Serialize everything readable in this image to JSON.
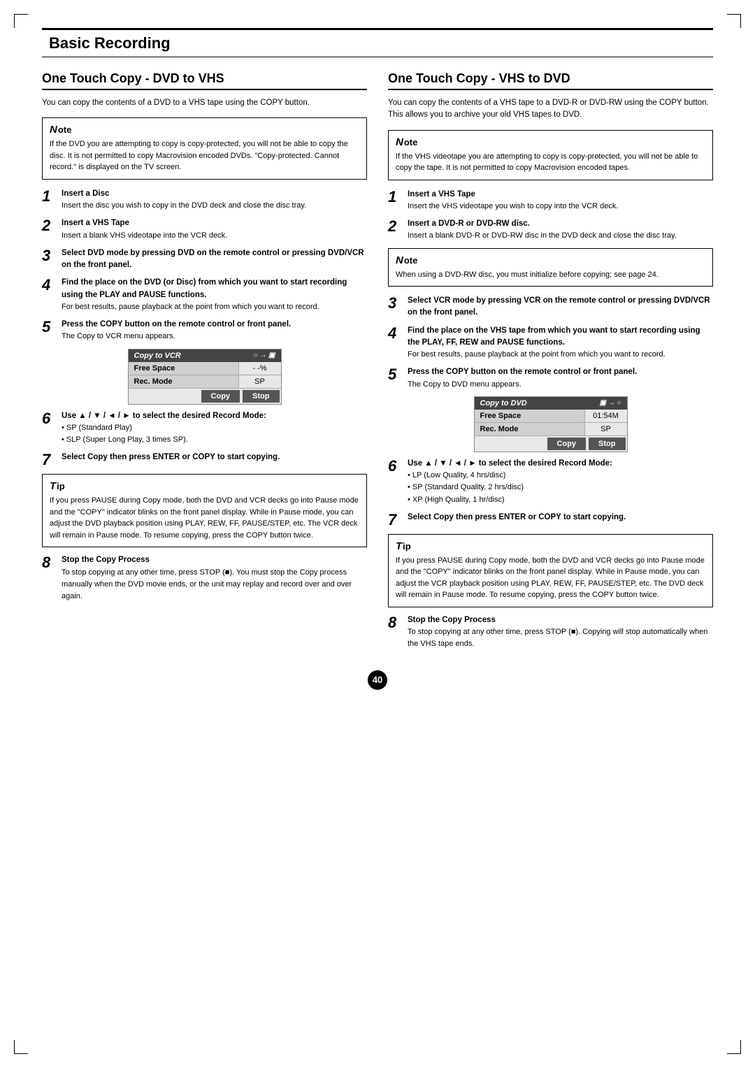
{
  "page": {
    "title": "Basic Recording",
    "page_number": "40"
  },
  "left_section": {
    "heading": "One Touch Copy - DVD to VHS",
    "intro": "You can copy the contents of a DVD to a VHS tape using the COPY button.",
    "note": {
      "title": "ote",
      "text": "If the DVD you are attempting to copy is copy-protected, you will not be able to copy the disc. It is not permitted to copy Macrovision encoded DVDs. \"Copy-protected. Cannot record.\" is displayed on the TV screen."
    },
    "steps": [
      {
        "num": "1",
        "title": "Insert a Disc",
        "body": "Insert the disc you wish to copy in the DVD deck and close the disc tray."
      },
      {
        "num": "2",
        "title": "Insert a VHS Tape",
        "body": "Insert a blank VHS videotape into the VCR deck."
      },
      {
        "num": "3",
        "title": "Select DVD mode by pressing DVD on the remote control or pressing DVD/VCR on the front panel.",
        "body": ""
      },
      {
        "num": "4",
        "title": "Find the place on the DVD (or Disc) from which you want to start recording using the PLAY and PAUSE functions.",
        "body": "For best results, pause playback at the point from which you want to record."
      },
      {
        "num": "5",
        "title": "Press the COPY button on the remote control or front panel.",
        "body": "The Copy to VCR menu appears."
      }
    ],
    "menu": {
      "title": "Copy to VCR",
      "icons": "○ → ▣",
      "rows": [
        {
          "label": "Free Space",
          "value": "- -%"
        },
        {
          "label": "Rec. Mode",
          "value": "SP"
        }
      ],
      "buttons": [
        "Copy",
        "Stop"
      ]
    },
    "steps2": [
      {
        "num": "6",
        "title": "Use ▲ / ▼ / ◄ / ► to select the desired Record Mode:",
        "body": "• SP (Standard Play)\n• SLP (Super Long Play, 3 times SP)."
      },
      {
        "num": "7",
        "title": "Select Copy then press ENTER or COPY to start copying.",
        "body": ""
      }
    ],
    "tip": {
      "title": "ip",
      "text": "If you press PAUSE during Copy mode, both the DVD and VCR decks go into Pause mode and the \"COPY\" indicator blinks on the front panel display. While in Pause mode, you can adjust the DVD playback position using PLAY, REW, FF, PAUSE/STEP, etc. The VCR deck will remain in Pause mode. To resume copying, press the COPY button twice."
    },
    "steps3": [
      {
        "num": "8",
        "title": "Stop the Copy Process",
        "body": "To stop copying at any other time, press STOP (■). You must stop the Copy process manually when the DVD movie ends, or the unit may replay and record over and over again."
      }
    ]
  },
  "right_section": {
    "heading": "One Touch Copy - VHS to DVD",
    "intro": "You can copy the contents of a VHS tape to a DVD-R or DVD-RW using the COPY button. This allows you to archive your old VHS tapes to DVD.",
    "note": {
      "title": "ote",
      "text": "If the VHS videotape you are attempting to copy is copy-protected, you will not be able to copy the tape. It is not permitted to copy Macrovision encoded tapes."
    },
    "steps": [
      {
        "num": "1",
        "title": "Insert a VHS Tape",
        "body": "Insert the VHS videotape you wish to copy into the VCR deck."
      },
      {
        "num": "2",
        "title": "Insert a DVD-R or DVD-RW disc.",
        "body": "Insert a blank DVD-R or DVD-RW disc in the DVD deck and close the disc tray."
      }
    ],
    "note2": {
      "title": "ote",
      "text": "When using a DVD-RW disc, you must initialize before copying; see page 24."
    },
    "steps2": [
      {
        "num": "3",
        "title": "Select VCR mode by pressing VCR on the remote control or pressing DVD/VCR on the front panel.",
        "body": ""
      },
      {
        "num": "4",
        "title": "Find the place on the VHS tape from which you want to start recording using the PLAY, FF, REW and PAUSE functions.",
        "body": "For best results, pause playback at the point from which you want to record."
      },
      {
        "num": "5",
        "title": "Press the COPY button on the remote control or front panel.",
        "body": "The Copy to DVD menu appears."
      }
    ],
    "menu": {
      "title": "Copy to DVD",
      "icons": "▣ → ○",
      "rows": [
        {
          "label": "Free Space",
          "value": "01:54M"
        },
        {
          "label": "Rec. Mode",
          "value": "SP"
        }
      ],
      "buttons": [
        "Copy",
        "Stop"
      ]
    },
    "steps3": [
      {
        "num": "6",
        "title": "Use ▲ / ▼ / ◄ / ► to select the desired Record Mode:",
        "body": "• LP (Low Quality, 4 hrs/disc)\n• SP (Standard Quality, 2 hrs/disc)\n• XP (High Quality, 1 hr/disc)"
      },
      {
        "num": "7",
        "title": "Select Copy then press ENTER or COPY to start copying.",
        "body": ""
      }
    ],
    "tip": {
      "title": "ip",
      "text": "If you press PAUSE during Copy mode, both the DVD and VCR decks go into Pause mode and the \"COPY\" indicator blinks on the front panel display. While in Pause mode, you can adjust the VCR playback position using PLAY, REW, FF, PAUSE/STEP, etc. The DVD deck will remain in Pause mode. To resume copying, press the COPY button twice."
    },
    "steps4": [
      {
        "num": "8",
        "title": "Stop the Copy Process",
        "body": "To stop copying at any other time, press STOP (■). Copying will stop automatically when the VHS tape ends."
      }
    ]
  }
}
